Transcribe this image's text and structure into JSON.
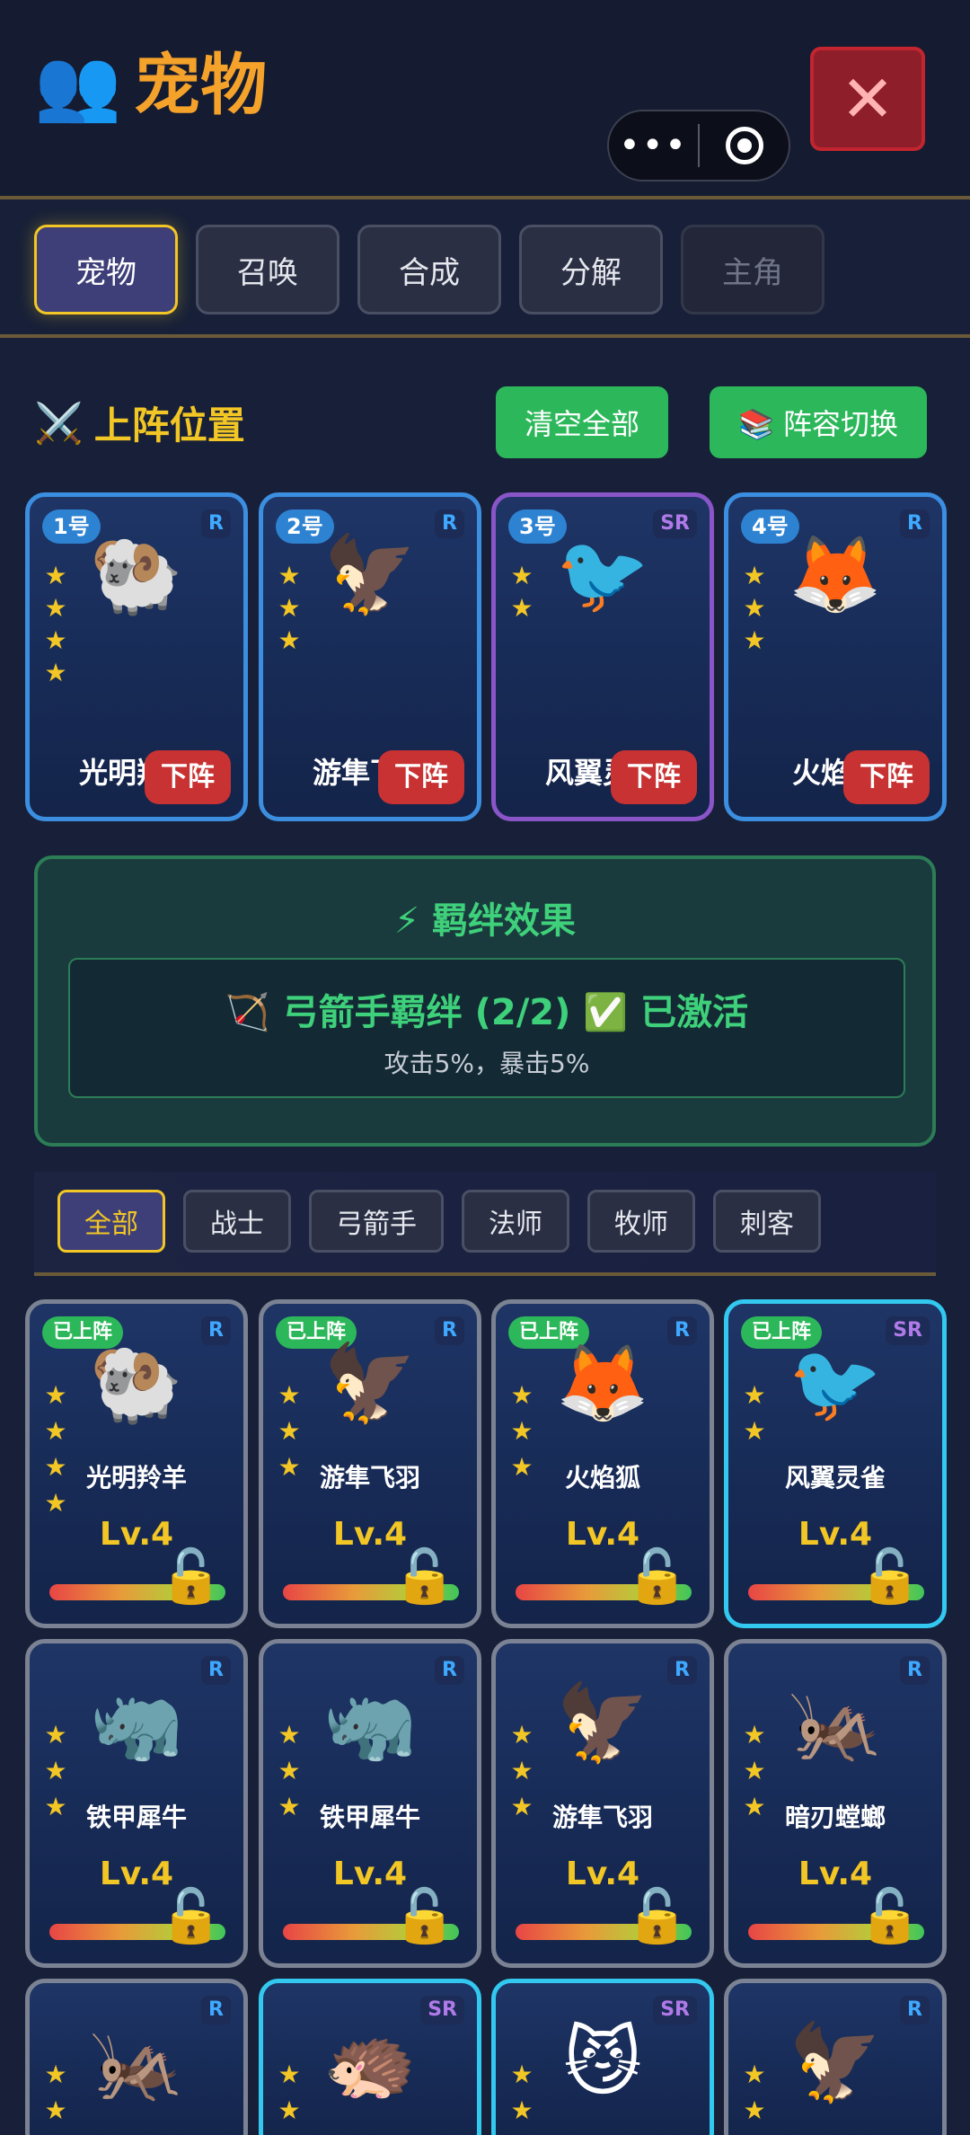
{
  "header": {
    "title_icon": "👥",
    "title": "宠物",
    "capsule_dots": "•••",
    "close_symbol": "✕"
  },
  "tabs": [
    {
      "label": "宠物",
      "state": "active"
    },
    {
      "label": "召唤",
      "state": "normal"
    },
    {
      "label": "合成",
      "state": "normal"
    },
    {
      "label": "分解",
      "state": "normal"
    },
    {
      "label": "主角",
      "state": "disabled"
    }
  ],
  "lineup": {
    "icon": "⚔️",
    "title": "上阵位置",
    "clear_label": "清空全部",
    "switch_label": "📚 阵容切换",
    "slots": [
      {
        "num": "1号",
        "rarity": "R",
        "emoji": "🐏",
        "stars": [
          "★",
          "★",
          "★",
          "★"
        ],
        "name": "光明羚羊",
        "remove": "下阵"
      },
      {
        "num": "2号",
        "rarity": "R",
        "emoji": "🦅",
        "stars": [
          "★",
          "★",
          "★"
        ],
        "name": "游隼飞羽",
        "remove": "下阵"
      },
      {
        "num": "3号",
        "rarity": "SR",
        "emoji": "🐦",
        "stars": [
          "★",
          "★"
        ],
        "name": "风翼灵雀",
        "remove": "下阵"
      },
      {
        "num": "4号",
        "rarity": "R",
        "emoji": "🦊",
        "stars": [
          "★",
          "★",
          "★"
        ],
        "name": "火焰狐",
        "remove": "下阵"
      }
    ]
  },
  "bond": {
    "title": "⚡ 羁绊效果",
    "effect": "🏹 弓箭手羁绊 (2/2) ✅ 已激活",
    "detail": "攻击5%，暴击5%"
  },
  "filters": [
    "全部",
    "战士",
    "弓箭手",
    "法师",
    "牧师",
    "刺客"
  ],
  "pets": [
    {
      "badge": "已上阵",
      "rarity": "R",
      "emoji": "🐏",
      "stars": [
        "★",
        "★",
        "★",
        "★"
      ],
      "name": "光明羚羊",
      "level": "Lv.4",
      "lock": "🔓",
      "border": "grey"
    },
    {
      "badge": "已上阵",
      "rarity": "R",
      "emoji": "🦅",
      "stars": [
        "★",
        "★",
        "★"
      ],
      "name": "游隼飞羽",
      "level": "Lv.4",
      "lock": "🔓",
      "border": "grey"
    },
    {
      "badge": "已上阵",
      "rarity": "R",
      "emoji": "🦊",
      "stars": [
        "★",
        "★",
        "★"
      ],
      "name": "火焰狐",
      "level": "Lv.4",
      "lock": "🔓",
      "border": "grey"
    },
    {
      "badge": "已上阵",
      "rarity": "SR",
      "emoji": "🐦",
      "stars": [
        "★",
        "★"
      ],
      "name": "风翼灵雀",
      "level": "Lv.4",
      "lock": "🔓",
      "border": "cyan"
    },
    {
      "badge": "",
      "rarity": "R",
      "emoji": "🦏",
      "stars": [
        "★",
        "★",
        "★"
      ],
      "name": "铁甲犀牛",
      "level": "Lv.4",
      "lock": "🔓",
      "border": "grey"
    },
    {
      "badge": "",
      "rarity": "R",
      "emoji": "🦏",
      "stars": [
        "★",
        "★",
        "★"
      ],
      "name": "铁甲犀牛",
      "level": "Lv.4",
      "lock": "🔓",
      "border": "grey"
    },
    {
      "badge": "",
      "rarity": "R",
      "emoji": "🦅",
      "stars": [
        "★",
        "★",
        "★"
      ],
      "name": "游隼飞羽",
      "level": "Lv.4",
      "lock": "🔓",
      "border": "grey"
    },
    {
      "badge": "",
      "rarity": "R",
      "emoji": "🦗",
      "stars": [
        "★",
        "★",
        "★"
      ],
      "name": "暗刃螳螂",
      "level": "Lv.4",
      "lock": "🔓",
      "border": "grey"
    },
    {
      "badge": "",
      "rarity": "R",
      "emoji": "🦗",
      "stars": [
        "★",
        "★"
      ],
      "name": "",
      "level": "",
      "lock": "",
      "border": "grey"
    },
    {
      "badge": "",
      "rarity": "SR",
      "emoji": "🦔",
      "stars": [
        "★",
        "★"
      ],
      "name": "",
      "level": "",
      "lock": "",
      "border": "cyan"
    },
    {
      "badge": "",
      "rarity": "SR",
      "emoji": "😼",
      "stars": [
        "★",
        "★"
      ],
      "name": "",
      "level": "",
      "lock": "",
      "border": "cyan"
    },
    {
      "badge": "",
      "rarity": "R",
      "emoji": "🦅",
      "stars": [
        "★",
        "★"
      ],
      "name": "",
      "level": "",
      "lock": "",
      "border": "grey"
    }
  ],
  "colors": {
    "accent_gold": "#f2c625",
    "title_orange": "#f5a22b",
    "green": "#2cb85a",
    "bond_green": "#3ed07a",
    "card_blue_border": "#3c8ee0",
    "card_sr_border": "#8a55c8",
    "card_cyan_border": "#33c8ef",
    "danger": "#c83232"
  }
}
